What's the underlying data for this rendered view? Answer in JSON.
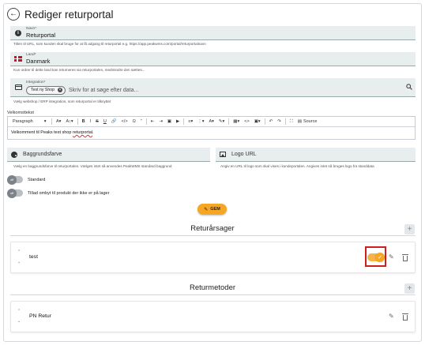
{
  "page": {
    "title": "Rediger returportal"
  },
  "name_field": {
    "label": "Navn*",
    "value": "Returportal",
    "hint": "Titlen til URL, som kunden skal bruge for at få adgang til returportal e.g. https://app.peakwms.com/portal/returportalnavn"
  },
  "country_field": {
    "label": "Land*",
    "value": "Danmark",
    "hint": "Kun ordrer til dette land kan returneres via returportalen, medmindre den sættes..."
  },
  "integration_field": {
    "label": "Integration*",
    "chip": "Test ny Shop",
    "placeholder": "Skriv for at søge efter data...",
    "hint": "Vælg webshop / ERP integration, som returportal er tilknyttet"
  },
  "editor": {
    "label": "Velkomsttekst",
    "paragraph_select": "Paragraph",
    "source_label": "Source",
    "content_plain": "Velkomment til Peaks test shop ",
    "content_spell": "returportal",
    "content_end": "."
  },
  "background_field": {
    "label": "Baggrundsfarve",
    "hint": "Vælg en baggrundsfarve til returportalen. Vælges intet så anvendes PeakWMS standard baggrund"
  },
  "logo_field": {
    "label": "Logo URL",
    "hint": "Angiv en URL til logo som skal vises i kundeportalen. Angives intet så bruges logo fra standdata"
  },
  "toggles": [
    {
      "label": "Standard",
      "state": "off"
    },
    {
      "label": "Tillad ombyt til produkt der ikke er på lager",
      "state": "off"
    }
  ],
  "save_button": {
    "label": "GEM"
  },
  "return_reasons": {
    "title": "Returårsager",
    "items": [
      {
        "label": "test",
        "active": true
      }
    ]
  },
  "return_methods": {
    "title": "Returmetoder",
    "items": [
      {
        "label": "PN Retur"
      }
    ]
  },
  "colors": {
    "accent": "#f5a623",
    "field_bg": "#e8eeee",
    "highlight": "#d0201c"
  }
}
